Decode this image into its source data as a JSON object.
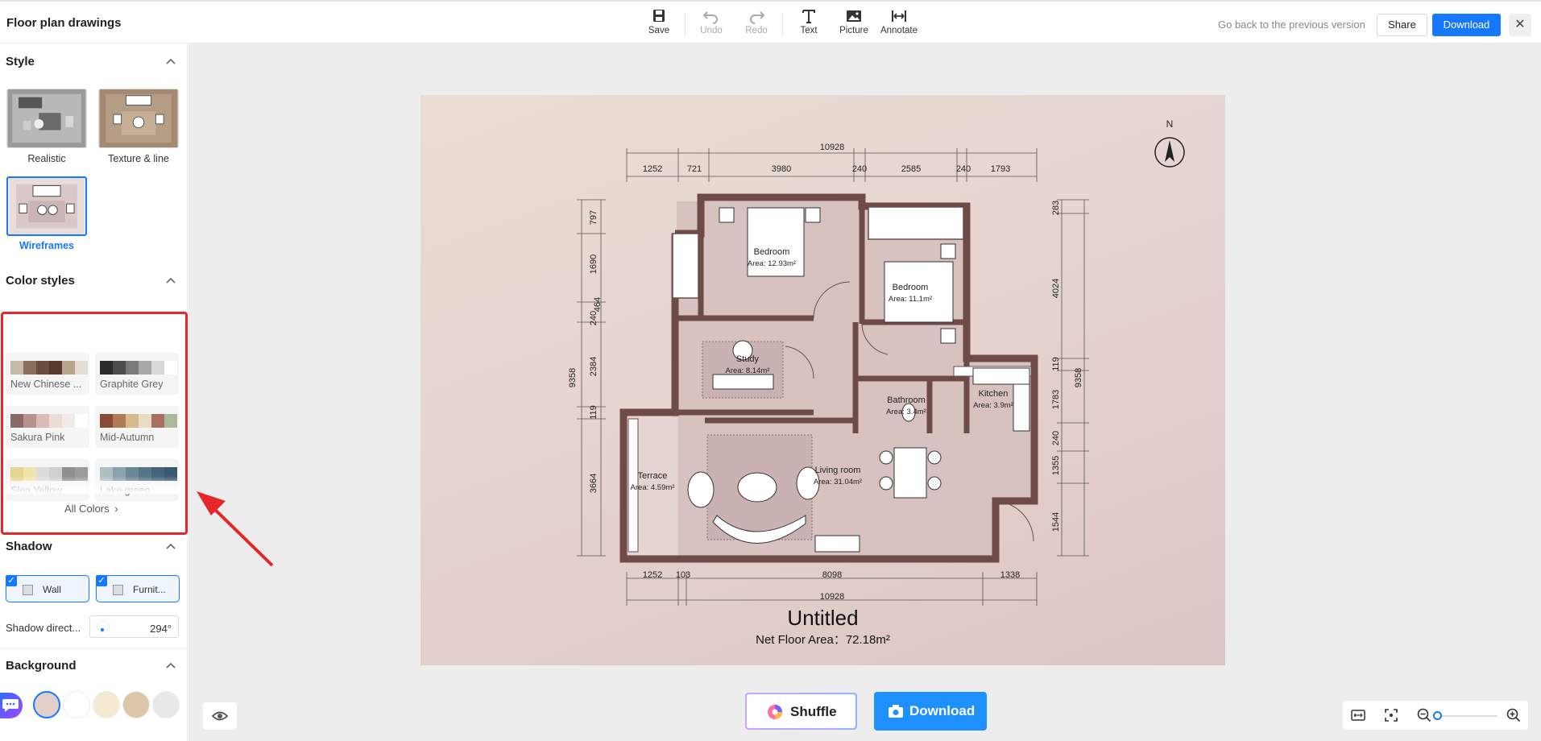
{
  "header": {
    "title": "Floor plan drawings",
    "go_back": "Go back to the previous version",
    "share_label": "Share",
    "download_label": "Download",
    "close_glyph": "✕"
  },
  "toolbar": {
    "save": "Save",
    "undo": "Undo",
    "redo": "Redo",
    "text": "Text",
    "picture": "Picture",
    "annotate": "Annotate"
  },
  "sidebar": {
    "style": {
      "heading": "Style",
      "options": [
        {
          "label": "Realistic",
          "selected": false
        },
        {
          "label": "Texture & line",
          "selected": false
        },
        {
          "label": "Wireframes",
          "selected": true
        }
      ]
    },
    "color_styles": {
      "heading": "Color styles",
      "swatches": [
        {
          "label": "New Chinese ...",
          "colors": [
            "#c7b9a8",
            "#8a6f5e",
            "#6b4d3e",
            "#5a3a2e",
            "#b9a58e",
            "#e4ddd2"
          ]
        },
        {
          "label": "Graphite Grey",
          "colors": [
            "#2c2c2c",
            "#4d4d4d",
            "#7a7a7a",
            "#a8a8a8",
            "#d9d9d9",
            "#ffffff"
          ]
        },
        {
          "label": "Sakura Pink",
          "colors": [
            "#8a6a66",
            "#b8918d",
            "#d9bcb7",
            "#ecdcd8",
            "#f3ebe8",
            "#ffffff"
          ]
        },
        {
          "label": "Mid-Autumn",
          "colors": [
            "#8a4a3a",
            "#b07a54",
            "#d8b98b",
            "#e8dcc4",
            "#a86f5c",
            "#a9b99a"
          ]
        },
        {
          "label": "Slea Yellow",
          "colors": [
            "#e8d48f",
            "#efe2ad",
            "#dcdcdc",
            "#cfcfcf",
            "#8f8f8f",
            "#9b9b9b"
          ]
        },
        {
          "label": "Lake green",
          "colors": [
            "#aebfc4",
            "#8aa2ad",
            "#6b8896",
            "#557486",
            "#45637a",
            "#3a5a72"
          ]
        }
      ],
      "all_colors": "All Colors"
    },
    "shadow": {
      "heading": "Shadow",
      "wall": "Wall",
      "furniture": "Furnit...",
      "direction_label": "Shadow direct...",
      "direction_value": "294°"
    },
    "background": {
      "heading": "Background",
      "colors": [
        "#e2cfc9",
        "#ffffff",
        "#f4ead2",
        "#dcc7a8",
        "#e8e8e8"
      ]
    }
  },
  "canvas": {
    "north_label": "N",
    "plan_title": "Untitled",
    "net_area": "Net Floor Area：72.18m²",
    "dims_top": {
      "total": "10928",
      "parts": [
        "1252",
        "721",
        "3980",
        "240",
        "2585",
        "240",
        "1793"
      ]
    },
    "dims_bottom": {
      "total": "10928",
      "parts": [
        "1252",
        "103",
        "8098",
        "1338"
      ]
    },
    "dims_left": {
      "total": "9358",
      "parts": [
        "797",
        "1690",
        "240",
        "464",
        "2384",
        "119",
        "3664"
      ]
    },
    "dims_right": {
      "total": "9358",
      "parts": [
        "283",
        "4024",
        "119",
        "1783",
        "240",
        "1355",
        "1544"
      ]
    },
    "rooms": [
      {
        "name": "Bedroom",
        "area": "Area: 12.93m²"
      },
      {
        "name": "Bedroom",
        "area": "Area: 11.1m²"
      },
      {
        "name": "Study",
        "area": "Area: 8.14m²"
      },
      {
        "name": "Bathroom",
        "area": "Area: 3.4m²"
      },
      {
        "name": "Kitchen",
        "area": "Area: 3.9m²"
      },
      {
        "name": "Living room",
        "area": "Area: 31.04m²"
      },
      {
        "name": "Terrace",
        "area": "Area: 4.59m²"
      }
    ]
  },
  "bottom": {
    "shuffle": "Shuffle",
    "download": "Download"
  },
  "colors": {
    "accent": "#1677ff",
    "highlight": "#e8262a",
    "wall": "#6e4a48"
  }
}
